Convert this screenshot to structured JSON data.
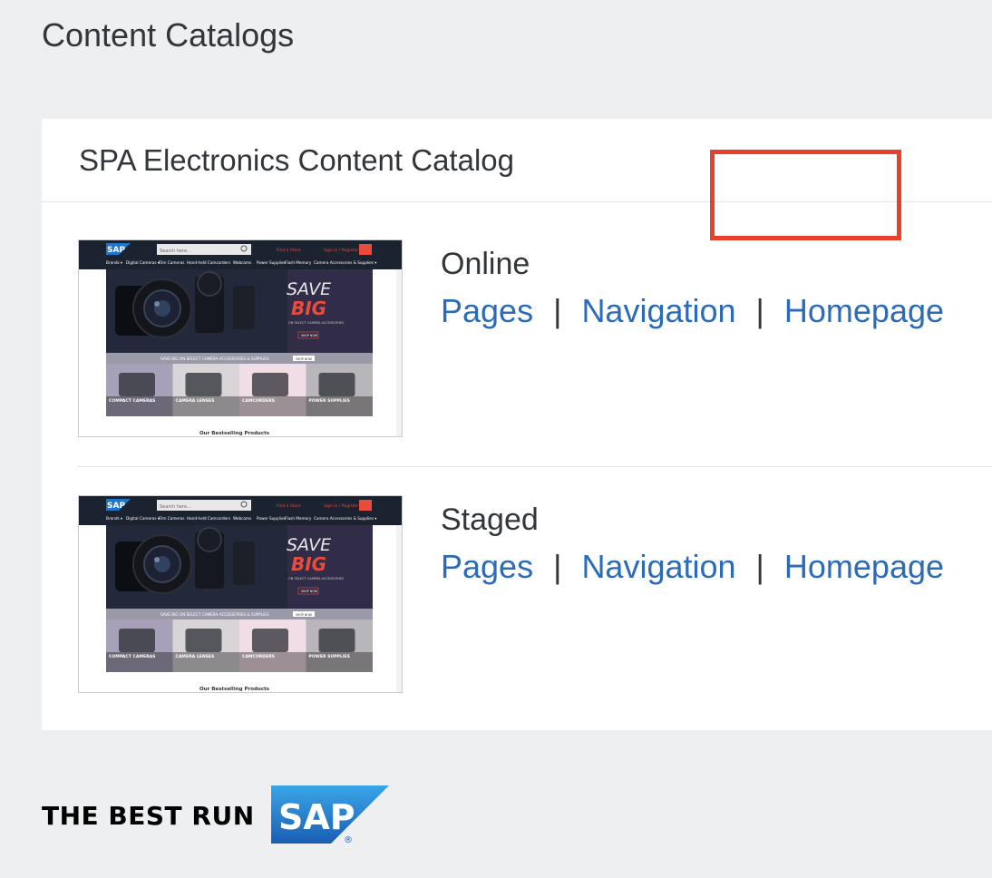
{
  "page": {
    "title": "Content Catalogs"
  },
  "catalog": {
    "title": "SPA Electronics Content Catalog",
    "versions": [
      {
        "name": "Online",
        "links": {
          "pages": "Pages",
          "navigation": "Navigation",
          "homepage": "Homepage"
        },
        "separator": "|"
      },
      {
        "name": "Staged",
        "links": {
          "pages": "Pages",
          "navigation": "Navigation",
          "homepage": "Homepage"
        },
        "separator": "|"
      }
    ]
  },
  "thumbnail": {
    "brand": "SAP",
    "search_placeholder": "Search here...",
    "store_link": "Find a Store",
    "signin": "Sign in / Register",
    "nav": [
      "Brands ▾",
      "Digital Cameras ▾",
      "Film Cameras",
      "Hand-held Camcorders",
      "Webcams",
      "Power Supplies",
      "Flash Memory",
      "Camera Accessories & Supplies ▾"
    ],
    "hero_line1": "SAVE",
    "hero_line2": "BIG",
    "hero_sub": "ON SELECT CAMERA ACCESSORIES",
    "hero_button": "SHOP NOW",
    "banner_text": "SAVE BIG ON SELECT CAMERA ACCESSORIES & SUPPLIES",
    "banner_button": "SHOP NOW",
    "tiles": [
      "COMPACT CAMERAS",
      "CAMERA LENSES",
      "CAMCORDERS",
      "POWER SUPPLIES"
    ],
    "bestsellers": "Our Bestselling Products"
  },
  "footer": {
    "tagline": "THE BEST RUN",
    "logo": "SAP",
    "registered": "®"
  },
  "colors": {
    "link": "#2b6bb8",
    "highlight": "#e8402a",
    "sap_blue": "#1f75c9"
  }
}
